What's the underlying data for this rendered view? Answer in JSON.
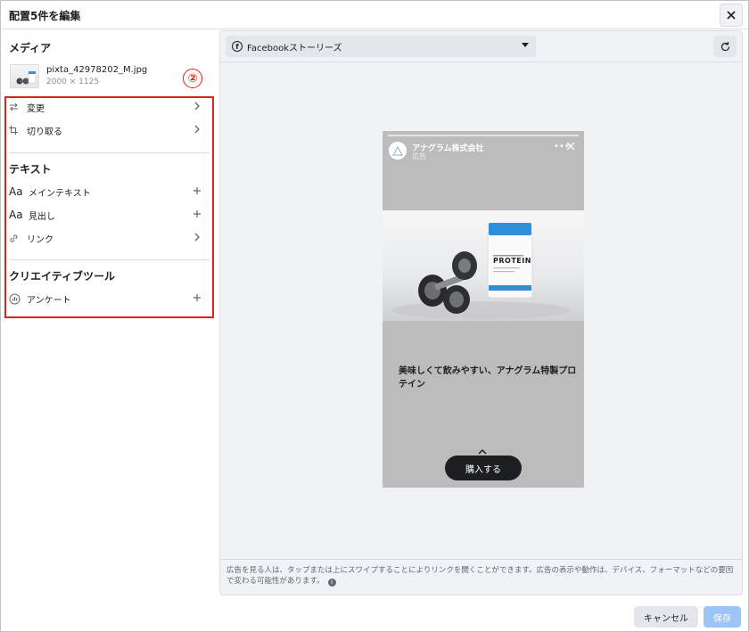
{
  "dialog": {
    "title": "配置5件を編集"
  },
  "media": {
    "section_title": "メディア",
    "file_name": "pixta_42978202_M.jpg",
    "dimensions": "2000 × 1125"
  },
  "annotation": {
    "badge": "②",
    "color": "#e2231a"
  },
  "media_actions": [
    {
      "label": "変更",
      "icon": "swap-arrows-icon"
    },
    {
      "label": "切り取る",
      "icon": "crop-icon"
    }
  ],
  "text_section": {
    "title": "テキスト",
    "items": [
      {
        "label": "メインテキスト",
        "icon": "Aa"
      },
      {
        "label": "見出し",
        "icon": "Aa"
      },
      {
        "label": "リンク",
        "icon": "link-icon"
      }
    ]
  },
  "creative_tools": {
    "title": "クリエイティブツール",
    "items": [
      {
        "label": "アンケート",
        "icon": "poll-icon"
      }
    ]
  },
  "preview": {
    "placement": "Facebookストーリーズ",
    "story": {
      "page_name": "アナグラム株式会社",
      "sponsored": "広告",
      "caption": "美味しくて飲みやすい、アナグラム特製プロテイン",
      "cta": "購入する",
      "product_label": "PROTEIN"
    },
    "notice": "広告を見る人は、タップまたは上にスワイプすることによりリンクを開くことができます。広告の表示や動作は、デバイス、フォーマットなどの要因で変わる可能性があります。"
  },
  "footer": {
    "cancel_label": "キャンセル",
    "save_label": "保存"
  },
  "colors": {
    "primary_disabled": "#9cc4f5",
    "panel_bg": "#f0f2f5",
    "annotation": "#e2231a"
  }
}
